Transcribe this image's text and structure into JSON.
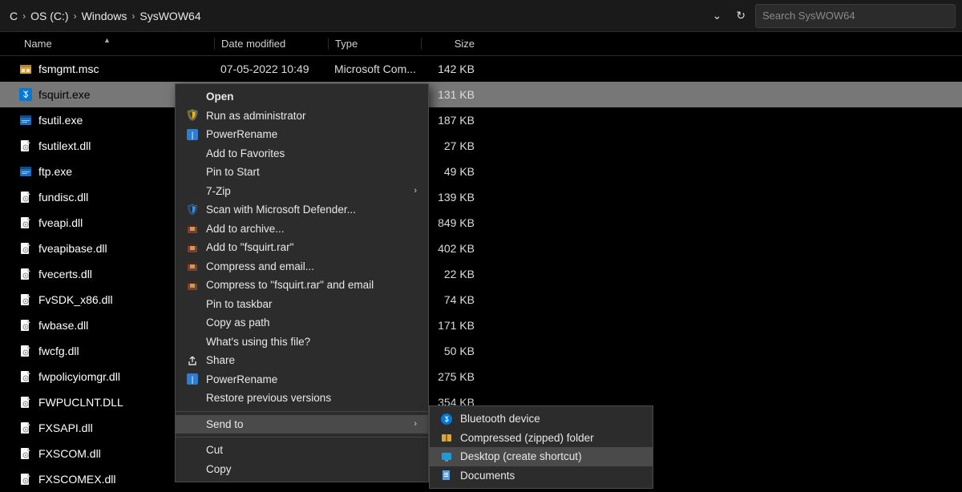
{
  "breadcrumbs": [
    "C",
    "OS (C:)",
    "Windows",
    "SysWOW64"
  ],
  "search": {
    "placeholder": "Search SysWOW64"
  },
  "columns": {
    "name": "Name",
    "date": "Date modified",
    "type": "Type",
    "size": "Size"
  },
  "files": [
    {
      "icon": "msc",
      "name": "fsmgmt.msc",
      "date": "07-05-2022 10:49",
      "type": "Microsoft Com...",
      "size": "142 KB",
      "selected": false
    },
    {
      "icon": "bt",
      "name": "fsquirt.exe",
      "date": "",
      "type": "",
      "size": "131 KB",
      "selected": true
    },
    {
      "icon": "exe",
      "name": "fsutil.exe",
      "date": "",
      "type": "",
      "size": "187 KB",
      "selected": false
    },
    {
      "icon": "dll",
      "name": "fsutilext.dll",
      "date": "",
      "type": "",
      "size": "27 KB",
      "selected": false
    },
    {
      "icon": "exe",
      "name": "ftp.exe",
      "date": "",
      "type": "",
      "size": "49 KB",
      "selected": false
    },
    {
      "icon": "dll",
      "name": "fundisc.dll",
      "date": "",
      "type": "",
      "size": "139 KB",
      "selected": false
    },
    {
      "icon": "dll",
      "name": "fveapi.dll",
      "date": "",
      "type": "",
      "size": "849 KB",
      "selected": false
    },
    {
      "icon": "dll",
      "name": "fveapibase.dll",
      "date": "",
      "type": "",
      "size": "402 KB",
      "selected": false
    },
    {
      "icon": "dll",
      "name": "fvecerts.dll",
      "date": "",
      "type": "",
      "size": "22 KB",
      "selected": false
    },
    {
      "icon": "dll",
      "name": "FvSDK_x86.dll",
      "date": "",
      "type": "",
      "size": "74 KB",
      "selected": false
    },
    {
      "icon": "dll",
      "name": "fwbase.dll",
      "date": "",
      "type": "",
      "size": "171 KB",
      "selected": false
    },
    {
      "icon": "dll",
      "name": "fwcfg.dll",
      "date": "",
      "type": "",
      "size": "50 KB",
      "selected": false
    },
    {
      "icon": "dll",
      "name": "fwpolicyiomgr.dll",
      "date": "",
      "type": "",
      "size": "275 KB",
      "selected": false
    },
    {
      "icon": "dll",
      "name": "FWPUCLNT.DLL",
      "date": "",
      "type": "",
      "size": "354 KB",
      "selected": false
    },
    {
      "icon": "dll",
      "name": "FXSAPI.dll",
      "date": "",
      "type": "",
      "size": "",
      "selected": false
    },
    {
      "icon": "dll",
      "name": "FXSCOM.dll",
      "date": "",
      "type": "",
      "size": "",
      "selected": false
    },
    {
      "icon": "dll",
      "name": "FXSCOMEX.dll",
      "date": "",
      "type": "",
      "size": "",
      "selected": false
    }
  ],
  "context_menu": [
    {
      "kind": "item",
      "label": "Open",
      "icon": "",
      "bold": true
    },
    {
      "kind": "item",
      "label": "Run as administrator",
      "icon": "shield"
    },
    {
      "kind": "item",
      "label": "PowerRename",
      "icon": "rename"
    },
    {
      "kind": "item",
      "label": "Add to Favorites",
      "icon": ""
    },
    {
      "kind": "item",
      "label": "Pin to Start",
      "icon": ""
    },
    {
      "kind": "item",
      "label": "7-Zip",
      "icon": "",
      "submenu": true
    },
    {
      "kind": "item",
      "label": "Scan with Microsoft Defender...",
      "icon": "defender"
    },
    {
      "kind": "item",
      "label": "Add to archive...",
      "icon": "rar"
    },
    {
      "kind": "item",
      "label": "Add to \"fsquirt.rar\"",
      "icon": "rar"
    },
    {
      "kind": "item",
      "label": "Compress and email...",
      "icon": "rar"
    },
    {
      "kind": "item",
      "label": "Compress to \"fsquirt.rar\" and email",
      "icon": "rar"
    },
    {
      "kind": "item",
      "label": "Pin to taskbar",
      "icon": ""
    },
    {
      "kind": "item",
      "label": "Copy as path",
      "icon": ""
    },
    {
      "kind": "item",
      "label": "What's using this file?",
      "icon": ""
    },
    {
      "kind": "item",
      "label": "Share",
      "icon": "share"
    },
    {
      "kind": "item",
      "label": "PowerRename",
      "icon": "rename"
    },
    {
      "kind": "item",
      "label": "Restore previous versions",
      "icon": ""
    },
    {
      "kind": "sep"
    },
    {
      "kind": "item",
      "label": "Send to",
      "icon": "",
      "submenu": true,
      "highlight": true
    },
    {
      "kind": "sep"
    },
    {
      "kind": "item",
      "label": "Cut",
      "icon": ""
    },
    {
      "kind": "item",
      "label": "Copy",
      "icon": ""
    }
  ],
  "send_to_submenu": [
    {
      "label": "Bluetooth device",
      "icon": "bt"
    },
    {
      "label": "Compressed (zipped) folder",
      "icon": "zip"
    },
    {
      "label": "Desktop (create shortcut)",
      "icon": "desktop",
      "highlight": true
    },
    {
      "label": "Documents",
      "icon": "docs"
    }
  ],
  "icons": {
    "msc": "🗃️",
    "bt": "",
    "exe": "",
    "dll": "",
    "shield": "🛡️",
    "rename": "",
    "defender": "🛡️",
    "rar": "📕",
    "share": "↗",
    "zip": "🗂️",
    "desktop": "🖥️",
    "docs": "📄"
  },
  "colors": {
    "bt_bg": "#0078d4",
    "exe_bg": "#1b6ec2",
    "dll_fg": "#eaeaea",
    "rename_bg": "#2d7dd2",
    "defender_fg": "#3a8ee6"
  }
}
